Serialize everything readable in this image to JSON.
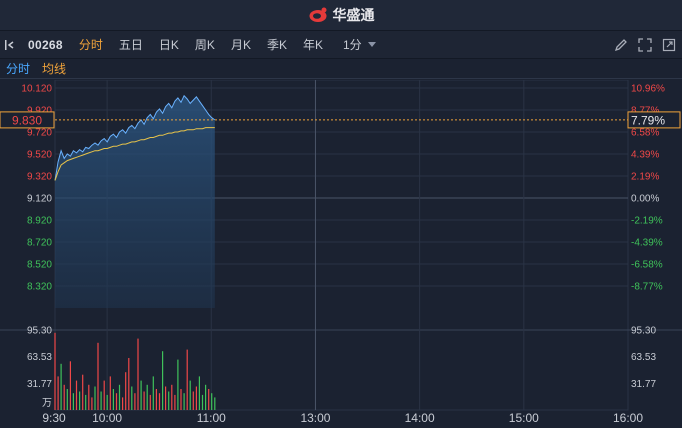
{
  "app": {
    "brand": "华盛通"
  },
  "toolbar": {
    "code": "00268",
    "tabs": [
      "分时",
      "五日",
      "日K",
      "周K",
      "月K",
      "季K",
      "年K"
    ],
    "active_tab": 0,
    "period": "1分"
  },
  "subtabs": {
    "timeshare": "分时",
    "avg_line": "均线"
  },
  "colors": {
    "up": "#f04848",
    "down": "#3fc25a",
    "flat": "#c8ccd4",
    "price_line": "#6ab2ff",
    "avg_line": "#e7c34a",
    "accent": "#f0a33a"
  },
  "chart_data": {
    "type": "line",
    "prev_close": 9.12,
    "price_ticks": [
      "10.120",
      "9.920",
      "9.720",
      "9.520",
      "9.320",
      "9.120",
      "8.920",
      "8.720",
      "8.520",
      "8.320"
    ],
    "pct_ticks": [
      "10.96%",
      "8.77%",
      "6.58%",
      "4.39%",
      "2.19%",
      "0.00%",
      "-2.19%",
      "-4.39%",
      "-6.58%",
      "-8.77%"
    ],
    "current_price": "9.830",
    "current_pct": "7.79%",
    "time_labels": [
      "9:30",
      "10:00",
      "11:00",
      "13:00",
      "14:00",
      "15:00",
      "16:00"
    ],
    "volume_ticks": [
      "95.30",
      "63.53",
      "31.77"
    ],
    "volume_unit": "万",
    "ylim": [
      8.12,
      10.12
    ],
    "volume_max": 95.3,
    "session_minutes": 330,
    "price": [
      9.28,
      9.45,
      9.55,
      9.48,
      9.52,
      9.5,
      9.55,
      9.53,
      9.56,
      9.54,
      9.58,
      9.57,
      9.6,
      9.62,
      9.6,
      9.64,
      9.66,
      9.63,
      9.68,
      9.7,
      9.67,
      9.72,
      9.74,
      9.71,
      9.76,
      9.78,
      9.75,
      9.8,
      9.83,
      9.79,
      9.85,
      9.88,
      9.84,
      9.9,
      9.93,
      9.89,
      9.95,
      9.98,
      9.94,
      10.0,
      10.03,
      9.99,
      10.05,
      10.02,
      9.98,
      10.01,
      10.04,
      10.0,
      9.96,
      9.92,
      9.88,
      9.85,
      9.83
    ],
    "avg": [
      9.28,
      9.36,
      9.42,
      9.44,
      9.46,
      9.47,
      9.48,
      9.49,
      9.5,
      9.51,
      9.52,
      9.53,
      9.54,
      9.55,
      9.55,
      9.56,
      9.57,
      9.57,
      9.58,
      9.59,
      9.59,
      9.6,
      9.61,
      9.61,
      9.62,
      9.63,
      9.63,
      9.64,
      9.65,
      9.65,
      9.66,
      9.67,
      9.67,
      9.68,
      9.69,
      9.69,
      9.7,
      9.71,
      9.71,
      9.72,
      9.72,
      9.73,
      9.73,
      9.74,
      9.74,
      9.74,
      9.75,
      9.75,
      9.75,
      9.76,
      9.76,
      9.76,
      9.76
    ],
    "volume": [
      92,
      40,
      55,
      30,
      25,
      58,
      20,
      35,
      22,
      42,
      18,
      30,
      15,
      28,
      80,
      22,
      35,
      18,
      40,
      25,
      20,
      30,
      15,
      45,
      62,
      28,
      20,
      85,
      35,
      22,
      30,
      18,
      40,
      25,
      20,
      70,
      28,
      22,
      30,
      18,
      60,
      25,
      20,
      72,
      35,
      22,
      28,
      40,
      18,
      30,
      25,
      20,
      15
    ],
    "volume_dir": [
      1,
      1,
      -1,
      1,
      -1,
      1,
      -1,
      1,
      -1,
      1,
      -1,
      1,
      1,
      -1,
      1,
      -1,
      1,
      -1,
      1,
      -1,
      1,
      -1,
      1,
      1,
      1,
      -1,
      1,
      1,
      -1,
      1,
      -1,
      1,
      -1,
      1,
      1,
      -1,
      1,
      -1,
      1,
      1,
      -1,
      1,
      -1,
      1,
      -1,
      1,
      1,
      -1,
      -1,
      -1,
      1,
      -1,
      -1
    ]
  }
}
